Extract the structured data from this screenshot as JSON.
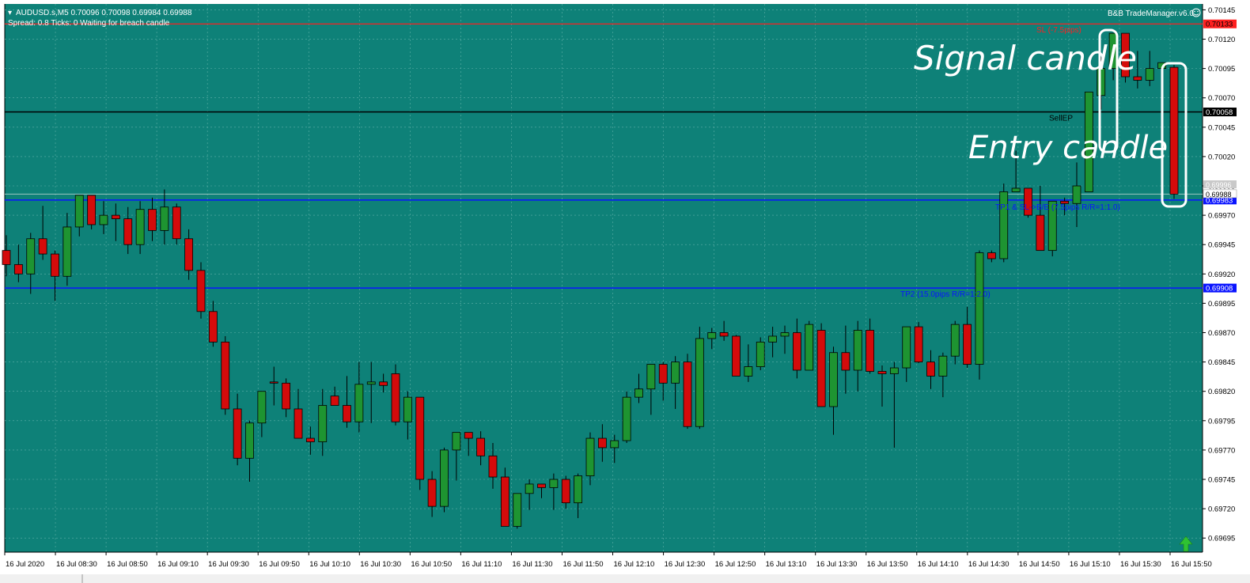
{
  "colors": {
    "chart_bg": "#0e8178",
    "bull": "#1e9431",
    "bear": "#d40b0b",
    "grid": "#5fb0a8",
    "sl_line": "#ff2020",
    "ep_line": "#000000",
    "tp_line": "#0a14ff"
  },
  "header": {
    "symbol_line": "AUDUSD.s,M5  0.70096 0.70098 0.69984 0.69988",
    "status_line": "Spread: 0.8   Ticks: 0   Waiting for breach candle",
    "indicator_label": "B&B TradeManager.v6.0",
    "smiley_icon": "smiley-face-icon"
  },
  "levels": {
    "sl": {
      "label": "SL (-7.5pips)",
      "price": "0.70133"
    },
    "entry": {
      "label": "SellEP",
      "price": "0.70058"
    },
    "tp1": {
      "label": "TP1 & SL->B/E (7.5pips R/R=1:1.0)",
      "price": "0.69983"
    },
    "tp2": {
      "label": "TP2 (15.0pips R/R=1:2.0)",
      "price": "0.69908"
    },
    "bid": {
      "price": "0.69988"
    },
    "ask": {
      "price": "0.69996"
    }
  },
  "annotations": {
    "signal": "Signal candle",
    "entry": "Entry candle"
  },
  "chart_data": {
    "type": "candlestick",
    "symbol": "AUDUSD.s",
    "timeframe": "M5",
    "ylim": [
      0.69683,
      0.7015
    ],
    "y_ticks": [
      "0.70145",
      "0.70120",
      "0.70095",
      "0.70070",
      "0.70045",
      "0.70020",
      "0.69995",
      "0.69970",
      "0.69945",
      "0.69920",
      "0.69895",
      "0.69870",
      "0.69845",
      "0.69820",
      "0.69795",
      "0.69770",
      "0.69745",
      "0.69720",
      "0.69695"
    ],
    "x_labels": [
      "16 Jul 2020",
      "16 Jul 08:30",
      "16 Jul 08:50",
      "16 Jul 09:10",
      "16 Jul 09:30",
      "16 Jul 09:50",
      "16 Jul 10:10",
      "16 Jul 10:30",
      "16 Jul 10:50",
      "16 Jul 11:10",
      "16 Jul 11:30",
      "16 Jul 11:50",
      "16 Jul 12:10",
      "16 Jul 12:30",
      "16 Jul 12:50",
      "16 Jul 13:10",
      "16 Jul 13:30",
      "16 Jul 13:50",
      "16 Jul 14:10",
      "16 Jul 14:30",
      "16 Jul 14:50",
      "16 Jul 15:10",
      "16 Jul 15:30",
      "16 Jul 15:50"
    ],
    "ohlc": [
      [
        0.6994,
        0.69953,
        0.69918,
        0.69928
      ],
      [
        0.69928,
        0.69945,
        0.69913,
        0.6992
      ],
      [
        0.6992,
        0.69955,
        0.69903,
        0.6995
      ],
      [
        0.6995,
        0.69978,
        0.69932,
        0.69937
      ],
      [
        0.69937,
        0.6994,
        0.69897,
        0.69918
      ],
      [
        0.69918,
        0.69972,
        0.6991,
        0.6996
      ],
      [
        0.6996,
        0.69987,
        0.69952,
        0.69987
      ],
      [
        0.69987,
        0.69983,
        0.69958,
        0.69962
      ],
      [
        0.69962,
        0.69982,
        0.69954,
        0.6997
      ],
      [
        0.6997,
        0.6998,
        0.69948,
        0.69967
      ],
      [
        0.69967,
        0.69977,
        0.69937,
        0.69945
      ],
      [
        0.69945,
        0.69982,
        0.69937,
        0.69975
      ],
      [
        0.69975,
        0.69985,
        0.69948,
        0.69957
      ],
      [
        0.69957,
        0.69992,
        0.69945,
        0.69977
      ],
      [
        0.69977,
        0.6998,
        0.69945,
        0.6995
      ],
      [
        0.6995,
        0.69958,
        0.69915,
        0.69923
      ],
      [
        0.69923,
        0.6993,
        0.69882,
        0.69888
      ],
      [
        0.69888,
        0.69897,
        0.69858,
        0.69862
      ],
      [
        0.69862,
        0.69867,
        0.698,
        0.69805
      ],
      [
        0.69805,
        0.69818,
        0.69757,
        0.69763
      ],
      [
        0.69763,
        0.69795,
        0.69743,
        0.69793
      ],
      [
        0.69793,
        0.6982,
        0.69781,
        0.6982
      ],
      [
        0.69828,
        0.69841,
        0.69808,
        0.69827
      ],
      [
        0.69827,
        0.69831,
        0.69798,
        0.69805
      ],
      [
        0.69805,
        0.69822,
        0.69787,
        0.6978
      ],
      [
        0.6978,
        0.6979,
        0.69766,
        0.69777
      ],
      [
        0.69777,
        0.69822,
        0.69765,
        0.69808
      ],
      [
        0.69816,
        0.69824,
        0.69812,
        0.69808
      ],
      [
        0.69808,
        0.69833,
        0.69789,
        0.69794
      ],
      [
        0.69794,
        0.69845,
        0.69785,
        0.69826
      ],
      [
        0.69826,
        0.69845,
        0.69793,
        0.69828
      ],
      [
        0.69828,
        0.69835,
        0.69819,
        0.69825
      ],
      [
        0.69835,
        0.69843,
        0.69791,
        0.69794
      ],
      [
        0.69794,
        0.6982,
        0.69779,
        0.69815
      ],
      [
        0.69815,
        0.6981,
        0.69736,
        0.69745
      ],
      [
        0.69745,
        0.69752,
        0.69713,
        0.69722
      ],
      [
        0.69722,
        0.69772,
        0.69717,
        0.6977
      ],
      [
        0.6977,
        0.6978,
        0.69744,
        0.69785
      ],
      [
        0.69785,
        0.69782,
        0.69765,
        0.6978
      ],
      [
        0.6978,
        0.69786,
        0.69757,
        0.69765
      ],
      [
        0.69765,
        0.69776,
        0.69737,
        0.69747
      ],
      [
        0.69747,
        0.69755,
        0.69705,
        0.69705
      ],
      [
        0.69705,
        0.69733,
        0.69703,
        0.69733
      ],
      [
        0.69733,
        0.69745,
        0.69719,
        0.69741
      ],
      [
        0.69741,
        0.69741,
        0.69729,
        0.69738
      ],
      [
        0.69738,
        0.6975,
        0.69719,
        0.69745
      ],
      [
        0.69745,
        0.69748,
        0.6972,
        0.69725
      ],
      [
        0.69725,
        0.6975,
        0.69712,
        0.69748
      ],
      [
        0.69748,
        0.69785,
        0.6974,
        0.6978
      ],
      [
        0.6978,
        0.69792,
        0.6976,
        0.69772
      ],
      [
        0.69772,
        0.69783,
        0.69759,
        0.69778
      ],
      [
        0.69778,
        0.6982,
        0.69776,
        0.69815
      ],
      [
        0.69815,
        0.69835,
        0.6981,
        0.69822
      ],
      [
        0.69822,
        0.6984,
        0.698,
        0.69843
      ],
      [
        0.69843,
        0.69845,
        0.69812,
        0.69827
      ],
      [
        0.69827,
        0.6985,
        0.69805,
        0.69845
      ],
      [
        0.69845,
        0.69852,
        0.69788,
        0.6979
      ],
      [
        0.6979,
        0.69875,
        0.69788,
        0.69865
      ],
      [
        0.69865,
        0.69874,
        0.69856,
        0.6987
      ],
      [
        0.6987,
        0.6988,
        0.69863,
        0.69867
      ],
      [
        0.69867,
        0.69868,
        0.69835,
        0.69833
      ],
      [
        0.69833,
        0.6986,
        0.69828,
        0.69841
      ],
      [
        0.69841,
        0.69866,
        0.69838,
        0.69862
      ],
      [
        0.69862,
        0.69875,
        0.69849,
        0.69867
      ],
      [
        0.69867,
        0.69876,
        0.69852,
        0.6987
      ],
      [
        0.6987,
        0.69882,
        0.69831,
        0.69838
      ],
      [
        0.69838,
        0.6988,
        0.69843,
        0.69877
      ],
      [
        0.69872,
        0.69878,
        0.69808,
        0.69807
      ],
      [
        0.69807,
        0.69858,
        0.69783,
        0.69853
      ],
      [
        0.69853,
        0.69876,
        0.69818,
        0.69838
      ],
      [
        0.69838,
        0.6988,
        0.6982,
        0.69872
      ],
      [
        0.69872,
        0.69882,
        0.69835,
        0.69837
      ],
      [
        0.69837,
        0.69842,
        0.69807,
        0.69835
      ],
      [
        0.69835,
        0.69845,
        0.69772,
        0.6984
      ],
      [
        0.6984,
        0.6987,
        0.69828,
        0.69875
      ],
      [
        0.69875,
        0.69879,
        0.69844,
        0.69845
      ],
      [
        0.69845,
        0.69855,
        0.69822,
        0.69833
      ],
      [
        0.69833,
        0.69853,
        0.69815,
        0.6985
      ],
      [
        0.6985,
        0.6988,
        0.69843,
        0.69877
      ],
      [
        0.69877,
        0.69892,
        0.6984,
        0.69843
      ],
      [
        0.69843,
        0.6994,
        0.6983,
        0.69938
      ],
      [
        0.69938,
        0.6994,
        0.6993,
        0.69933
      ],
      [
        0.69933,
        0.69997,
        0.6993,
        0.6999
      ],
      [
        0.6999,
        0.70025,
        0.6999,
        0.69993
      ],
      [
        0.69993,
        0.6999,
        0.69968,
        0.6997
      ],
      [
        0.6997,
        0.69995,
        0.6994,
        0.6994
      ],
      [
        0.6994,
        0.69982,
        0.69935,
        0.69982
      ],
      [
        0.69982,
        0.69985,
        0.6997,
        0.6998
      ],
      [
        0.6998,
        0.70015,
        0.6996,
        0.69995
      ],
      [
        0.6999,
        0.70075,
        0.69995,
        0.70075
      ],
      [
        0.70072,
        0.70105,
        0.7006,
        0.70095
      ],
      [
        0.70095,
        0.70123,
        0.70085,
        0.70125
      ],
      [
        0.70125,
        0.70118,
        0.70083,
        0.70088
      ],
      [
        0.70088,
        0.7011,
        0.70078,
        0.70085
      ],
      [
        0.70085,
        0.7011,
        0.7008,
        0.70095
      ],
      [
        0.70095,
        0.701,
        0.70076,
        0.701
      ],
      [
        0.70096,
        0.70098,
        0.69984,
        0.69988
      ]
    ]
  }
}
